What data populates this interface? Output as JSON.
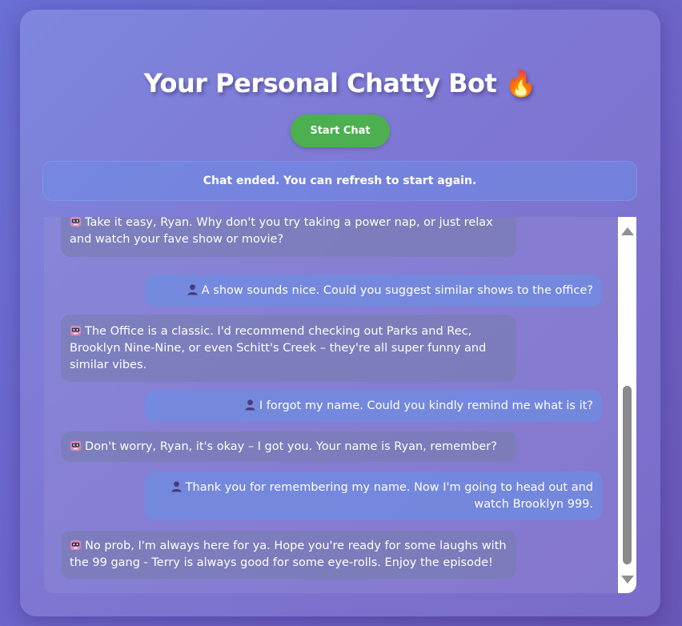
{
  "page": {
    "title": "Your Personal Chatty Bot 🔥",
    "start_button": "Start Chat",
    "status": "Chat ended. You can refresh to start again."
  },
  "colors": {
    "start_button": "#4caf50",
    "bot_bubble": "#7a7fb0",
    "user_bubble": "#6e8ce1"
  },
  "icons": {
    "bot": "robot-icon",
    "user": "user-silhouette-icon"
  },
  "messages": [
    {
      "role": "bot",
      "text": "Take it easy, Ryan. Why don't you try taking a power nap, or just relax and watch your fave show or movie?"
    },
    {
      "role": "user",
      "text": "A show sounds nice. Could you suggest similar shows to the office?"
    },
    {
      "role": "bot",
      "text": "The Office is a classic. I'd recommend checking out Parks and Rec, Brooklyn Nine-Nine, or even Schitt's Creek – they're all super funny and similar vibes."
    },
    {
      "role": "user",
      "text": "I forgot my name. Could you kindly remind me what is it?"
    },
    {
      "role": "bot",
      "text": "Don't worry, Ryan, it's okay – I got you. Your name is Ryan, remember?"
    },
    {
      "role": "user",
      "text": "Thank you for remembering my name. Now I'm going to head out and watch Brooklyn 999."
    },
    {
      "role": "bot",
      "text": "No prob, I'm always here for ya. Hope you're ready for some laughs with the 99 gang - Terry is always good for some eye-rolls. Enjoy the episode!"
    }
  ]
}
